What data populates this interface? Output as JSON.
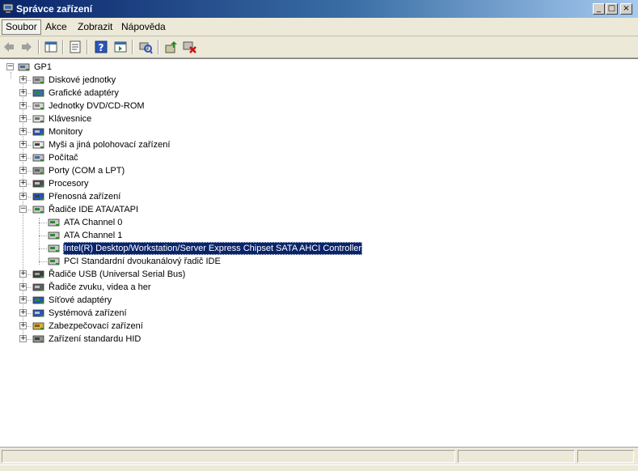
{
  "window": {
    "title": "Správce zařízení",
    "min_glyph": "_",
    "max_glyph": "□",
    "close_glyph": "×"
  },
  "menu": {
    "items": [
      {
        "label": "Soubor",
        "active": true
      },
      {
        "label": "Akce",
        "active": false
      },
      {
        "label": "Zobrazit",
        "active": false
      },
      {
        "label": "Nápověda",
        "active": false
      }
    ]
  },
  "toolbar": {
    "buttons": [
      "back-icon",
      "forward-icon",
      "show-hide-console-tree-icon",
      "properties-icon",
      "help-icon",
      "action-pane-icon",
      "scan-hardware-icon",
      "update-driver-icon",
      "uninstall-icon"
    ]
  },
  "tree": {
    "root": {
      "label": "GP1",
      "icon": "computer-icon"
    },
    "items": [
      {
        "label": "Diskové jednotky",
        "icon": "disk-drive-icon",
        "level": 1,
        "expander": "+"
      },
      {
        "label": "Grafické adaptéry",
        "icon": "display-adapter-icon",
        "level": 1,
        "expander": "+"
      },
      {
        "label": "Jednotky DVD/CD-ROM",
        "icon": "dvd-drive-icon",
        "level": 1,
        "expander": "+"
      },
      {
        "label": "Klávesnice",
        "icon": "keyboard-icon",
        "level": 1,
        "expander": "+"
      },
      {
        "label": "Monitory",
        "icon": "monitor-icon",
        "level": 1,
        "expander": "+"
      },
      {
        "label": "Myši a jiná polohovací zařízení",
        "icon": "mouse-icon",
        "level": 1,
        "expander": "+"
      },
      {
        "label": "Počítač",
        "icon": "computer-icon",
        "level": 1,
        "expander": "+"
      },
      {
        "label": "Porty (COM a LPT)",
        "icon": "port-icon",
        "level": 1,
        "expander": "+"
      },
      {
        "label": "Procesory",
        "icon": "processor-icon",
        "level": 1,
        "expander": "+"
      },
      {
        "label": "Přenosná zařízení",
        "icon": "portable-device-icon",
        "level": 1,
        "expander": "+"
      },
      {
        "label": "Řadiče IDE ATA/ATAPI",
        "icon": "ide-controller-icon",
        "level": 1,
        "expander": "−"
      },
      {
        "label": "ATA Channel 0",
        "icon": "ide-channel-icon",
        "level": 2
      },
      {
        "label": "ATA Channel 1",
        "icon": "ide-channel-icon",
        "level": 2
      },
      {
        "label": "Intel(R) Desktop/Workstation/Server Express Chipset SATA AHCI Controller",
        "icon": "ide-channel-icon",
        "level": 2,
        "selected": true
      },
      {
        "label": "PCI Standardní dvoukanálový řadič IDE",
        "icon": "ide-channel-icon",
        "level": 2
      },
      {
        "label": "Řadiče USB (Universal Serial Bus)",
        "icon": "usb-icon",
        "level": 1,
        "expander": "+"
      },
      {
        "label": "Řadiče zvuku, videa a her",
        "icon": "sound-icon",
        "level": 1,
        "expander": "+"
      },
      {
        "label": "Síťové adaptéry",
        "icon": "network-adapter-icon",
        "level": 1,
        "expander": "+"
      },
      {
        "label": "Systémová zařízení",
        "icon": "system-device-icon",
        "level": 1,
        "expander": "+"
      },
      {
        "label": "Zabezpečovací zařízení",
        "icon": "security-device-icon",
        "level": 1,
        "expander": "+"
      },
      {
        "label": "Zařízení standardu HID",
        "icon": "hid-icon",
        "level": 1,
        "expander": "+"
      }
    ]
  },
  "colors": {
    "selection": "#0a246a",
    "titlebar": "#0a246a",
    "chrome": "#ece9d8"
  }
}
